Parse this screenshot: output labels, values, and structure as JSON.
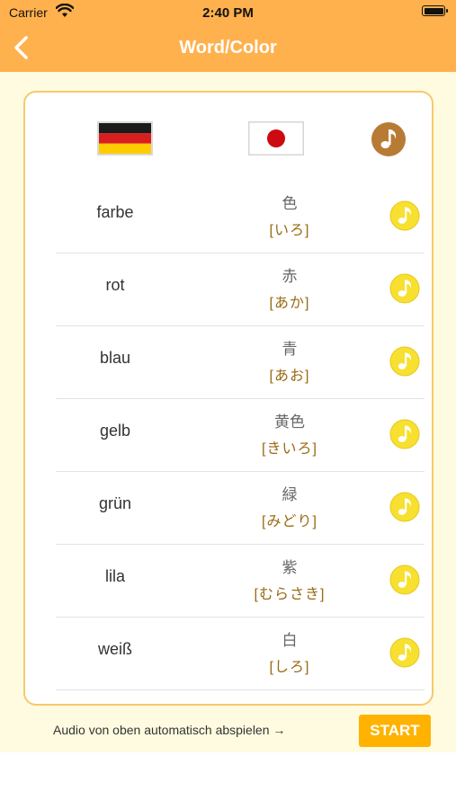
{
  "status": {
    "carrier": "Carrier",
    "time": "2:40 PM"
  },
  "nav": {
    "title": "Word/Color"
  },
  "header": {
    "left_flag": "germany-flag",
    "right_flag": "japan-flag",
    "play_all_icon": "music-note-icon"
  },
  "rows": [
    {
      "de": "farbe",
      "kanji": "色",
      "kana": "[いろ]"
    },
    {
      "de": "rot",
      "kanji": "赤",
      "kana": "[あか]"
    },
    {
      "de": "blau",
      "kanji": "青",
      "kana": "[あお]"
    },
    {
      "de": "gelb",
      "kanji": "黄色",
      "kana": "[きいろ]"
    },
    {
      "de": "grün",
      "kanji": "緑",
      "kana": "[みどり]"
    },
    {
      "de": "lila",
      "kanji": "紫",
      "kana": "[むらさき]"
    },
    {
      "de": "weiß",
      "kanji": "白",
      "kana": "[しろ]"
    }
  ],
  "footer": {
    "autoplay_label": "Audio von oben automatisch abspielen →",
    "start_label": "START"
  },
  "colors": {
    "nav_bg": "#ffb14e",
    "content_bg": "#fffbe0",
    "card_border": "#f6c96b",
    "note_yellow": "#f7e02f",
    "header_note_brown": "#b87b35",
    "start_bg": "#ffb300",
    "kana_text": "#9a6a12"
  }
}
